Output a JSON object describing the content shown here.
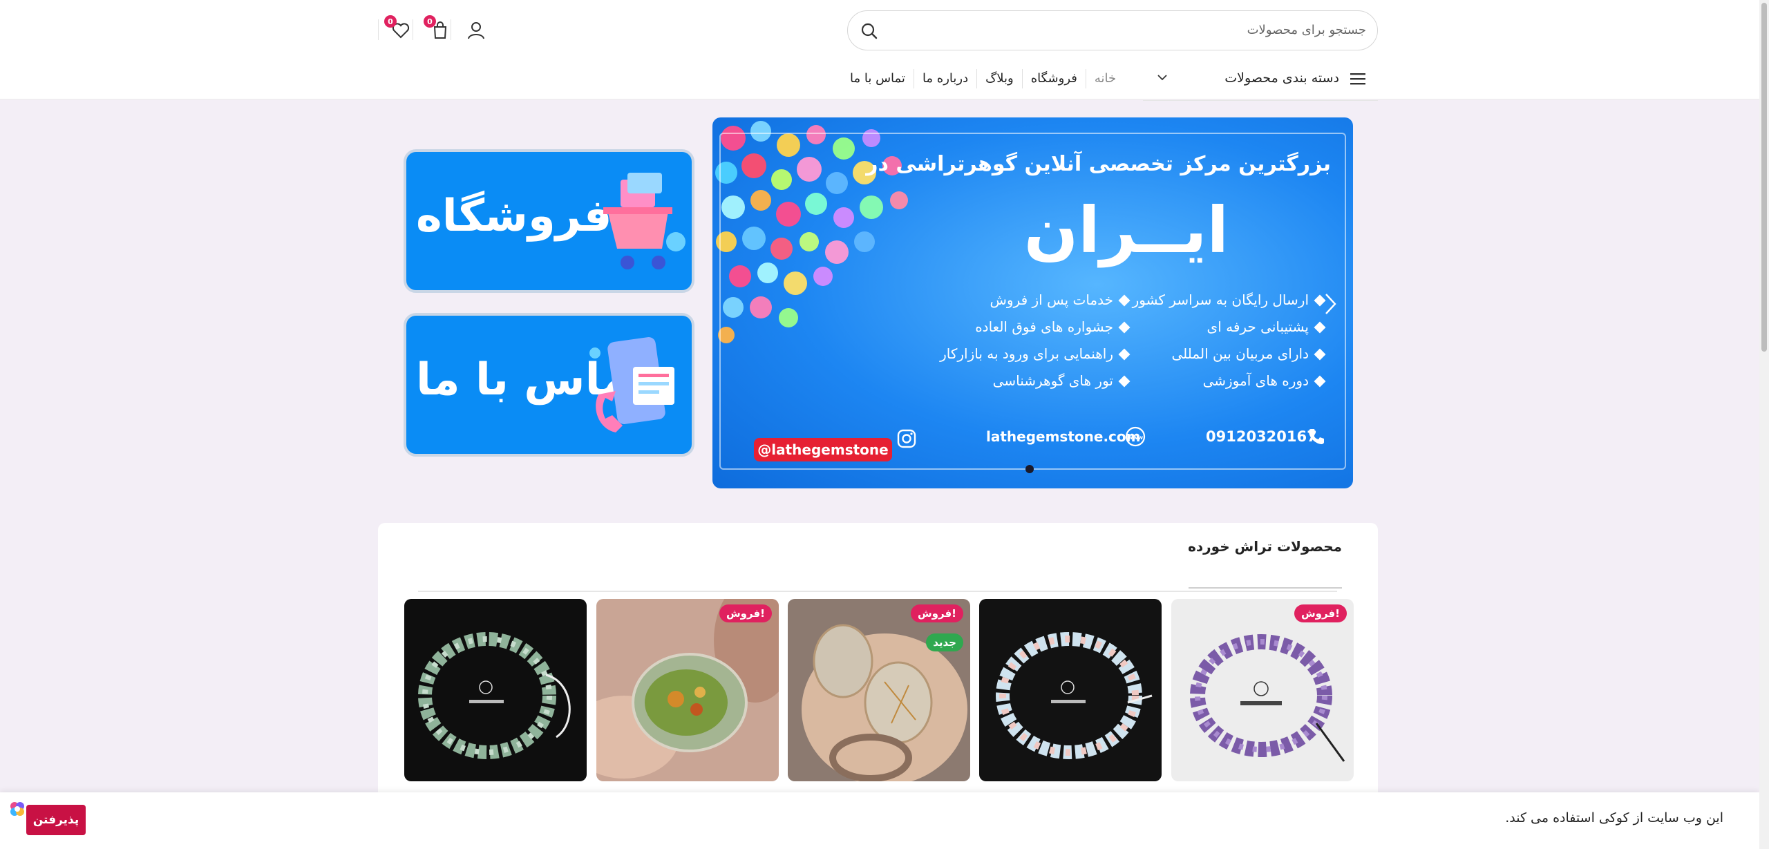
{
  "header": {
    "search": {
      "placeholder": "جستجو برای محصولات"
    },
    "wishlist_count": "0",
    "cart_count": "0"
  },
  "nav": {
    "categories_label": "دسته بندی محصولات",
    "links": [
      {
        "label": "خانه"
      },
      {
        "label": "فروشگاه"
      },
      {
        "label": "وبلاگ"
      },
      {
        "label": "درباره ما"
      },
      {
        "label": "تماس با ما"
      }
    ]
  },
  "slider": {
    "title": "بزرگترین مرکز تخصصی آنلاین گوهرتراشی در",
    "big": "ایــران",
    "features_right": [
      "ارسال رایگان به سراسر کشور",
      "پشتیبانی حرفه ای",
      "دارای مربیان بین المللی",
      "دوره های آموزشی"
    ],
    "features_left": [
      "خدمات پس از فروش",
      "جشواره های فوق العاده",
      "راهنمایی برای ورود به بازارکار",
      "تور های گوهرشناسی"
    ],
    "phone": "09120320167",
    "website": "lathegemstone.com",
    "instagram": "@lathegemstone"
  },
  "promos": {
    "shop": "فروشگاه",
    "contact": "تماس با ما"
  },
  "products": {
    "title": "محصولات تراش خورده",
    "items": [
      {
        "image": "amethyst-chip-bracelet",
        "sale": "!فروش",
        "new": ""
      },
      {
        "image": "rose-quartz-chip-bracelet",
        "sale": "",
        "new": ""
      },
      {
        "image": "rutilated-quartz-cabochons",
        "sale": "!فروش",
        "new": "جدید"
      },
      {
        "image": "moss-agate-cabochon",
        "sale": "!فروش",
        "new": ""
      },
      {
        "image": "aventurine-chip-bracelet",
        "sale": "",
        "new": ""
      }
    ]
  },
  "cookie": {
    "text": "این وب سایت از کوکی استفاده می کند.",
    "accept": "پذیرفتن"
  },
  "colors": {
    "accent": "#e0215f",
    "slider_blue": "#1d86f2",
    "new_badge": "#2fa84f",
    "page_bg": "#f3eef6"
  }
}
